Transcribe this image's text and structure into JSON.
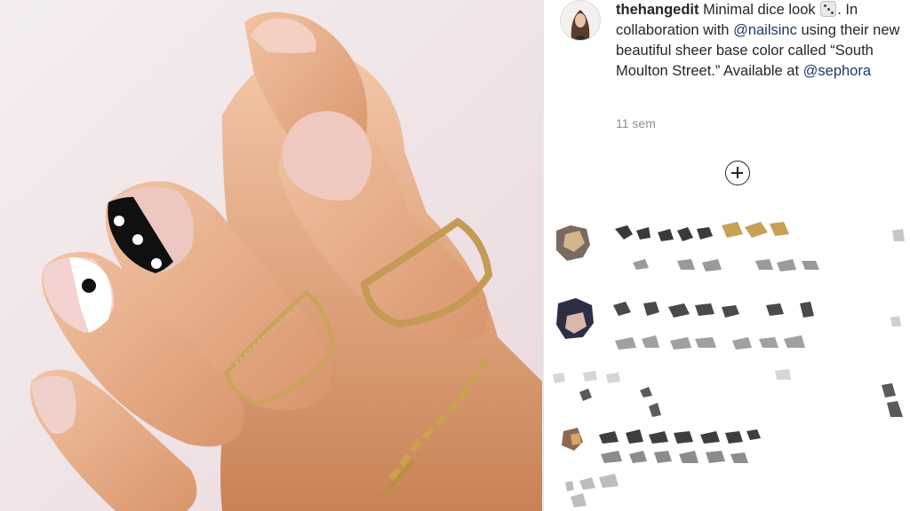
{
  "post": {
    "username": "thehangedit",
    "caption_intro": " Minimal dice look ",
    "emoji_icon": "dice-icon",
    "caption_mid1": ". In collaboration with ",
    "mention_1": "@nailsinc",
    "caption_mid2": " using their new beautiful sheer base color called “South Moulton Street.” Available at ",
    "mention_2": "@sephora",
    "timestamp": "11 sem"
  },
  "actions": {
    "load_more_icon": "plus-circle-icon"
  },
  "comments": [
    {
      "state": "pixelated"
    },
    {
      "state": "pixelated"
    },
    {
      "state": "pixelated"
    }
  ],
  "colors": {
    "mention": "#1a3a6b",
    "text": "#262626",
    "muted": "#8e8e8e",
    "photo_background": "#f1e6e8"
  }
}
